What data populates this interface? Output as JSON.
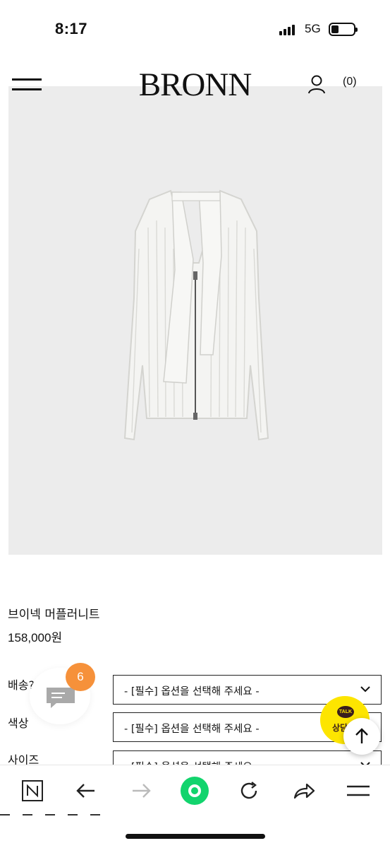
{
  "status_bar": {
    "time": "8:17",
    "network": "5G"
  },
  "header": {
    "logo": "BRONN",
    "cart_count": "(0)"
  },
  "product": {
    "name": "브이넥 머플러니트",
    "price": "158,000원"
  },
  "options": [
    {
      "label": "배송?",
      "placeholder": "- [필수] 옵션을 선택해 주세요 -"
    },
    {
      "label": "색상",
      "placeholder": "- [필수] 옵션을 선택해 주세요 -"
    },
    {
      "label": "사이즈",
      "placeholder": "- [필수] 옵션을 선택해 주세요 -"
    }
  ],
  "floating": {
    "chat_badge": "6",
    "kakao_small": "TALK",
    "kakao_label": "상담"
  },
  "toolbar": {
    "icons": [
      "naver-n-icon",
      "back-arrow-icon",
      "forward-arrow-icon",
      "home-dot-icon",
      "refresh-icon",
      "share-icon",
      "menu-icon"
    ]
  },
  "colors": {
    "accent_green": "#12d46d",
    "kakao_yellow": "#fde500",
    "badge_orange": "#f6913a",
    "image_bg": "#ececec"
  }
}
